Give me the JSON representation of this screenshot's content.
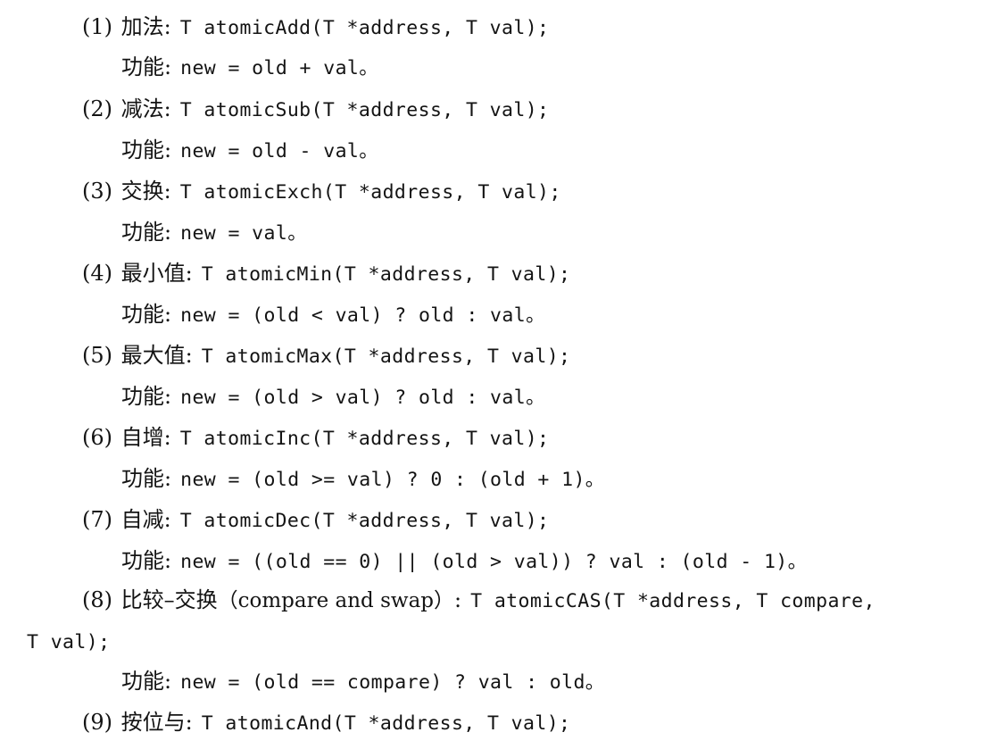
{
  "items": [
    {
      "num": "(1)",
      "label": "加法",
      "sig": "T atomicAdd(T *address, T val);",
      "desc": "new = old + val。"
    },
    {
      "num": "(2)",
      "label": "减法",
      "sig": "T atomicSub(T *address, T val);",
      "desc": "new = old - val。"
    },
    {
      "num": "(3)",
      "label": "交换",
      "sig": "T atomicExch(T *address, T val);",
      "desc": "new = val。"
    },
    {
      "num": "(4)",
      "label": "最小值",
      "sig": "T atomicMin(T *address, T val);",
      "desc": "new = (old < val) ? old : val。"
    },
    {
      "num": "(5)",
      "label": "最大值",
      "sig": "T atomicMax(T *address, T val);",
      "desc": "new = (old > val) ? old : val。"
    },
    {
      "num": "(6)",
      "label": "自增",
      "sig": "T atomicInc(T *address, T val);",
      "desc": "new = (old >= val) ? 0 : (old + 1)。"
    },
    {
      "num": "(7)",
      "label": "自减",
      "sig": "T atomicDec(T *address, T val);",
      "desc": "new = ((old == 0) || (old > val)) ? val : (old - 1)。"
    },
    {
      "num": "(8)",
      "label": "比较–交换",
      "label_note": "（compare and swap）",
      "sig": "T atomicCAS(T *address, T compare,",
      "sig_cont": "T val);",
      "desc": "new = (old == compare) ? val : old。"
    },
    {
      "num": "(9)",
      "label": "按位与",
      "sig": "T atomicAnd(T *address, T val);"
    }
  ],
  "desc_label": "功能",
  "colon": ":"
}
